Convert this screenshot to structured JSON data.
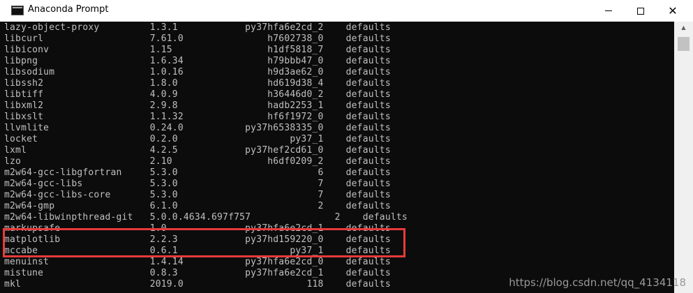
{
  "window": {
    "title": "Anaconda Prompt"
  },
  "terminal_lines": [
    "lazy-object-proxy         1.3.1            py37hfa6e2cd_2    defaults",
    "libcurl                   7.61.0               h7602738_0    defaults",
    "libiconv                  1.15                 h1df5818_7    defaults",
    "libpng                    1.6.34               h79bbb47_0    defaults",
    "libsodium                 1.0.16               h9d3ae62_0    defaults",
    "libssh2                   1.8.0                hd619d38_4    defaults",
    "libtiff                   4.0.9                h36446d0_2    defaults",
    "libxml2                   2.9.8                hadb2253_1    defaults",
    "libxslt                   1.1.32               hf6f1972_0    defaults",
    "llvmlite                  0.24.0           py37h6538335_0    defaults",
    "locket                    0.2.0                    py37_1    defaults",
    "lxml                      4.2.5            py37hef2cd61_0    defaults",
    "lzo                       2.10                 h6df0209_2    defaults",
    "m2w64-gcc-libgfortran     5.3.0                         6    defaults",
    "m2w64-gcc-libs            5.3.0                         7    defaults",
    "m2w64-gcc-libs-core       5.3.0                         7    defaults",
    "m2w64-gmp                 6.1.0                         2    defaults",
    "m2w64-libwinpthread-git   5.0.0.4634.697f757               2    defaults",
    "markupsafe                1.0              py37hfa6e2cd_1    defaults",
    "matplotlib                2.2.3            py37hd159220_0    defaults",
    "mccabe                    0.6.1                    py37_1    defaults",
    "menuinst                  1.4.14           py37hfa6e2cd_0    defaults",
    "mistune                   0.8.3            py37hfa6e2cd_1    defaults",
    "mkl                       2019.0                      118    defaults"
  ],
  "watermark": "https://blog.csdn.net/qq_4134118",
  "colors": {
    "terminal_bg": "#0c0c0c",
    "terminal_fg": "#c0c0c0",
    "highlight": "#e83a3a"
  }
}
